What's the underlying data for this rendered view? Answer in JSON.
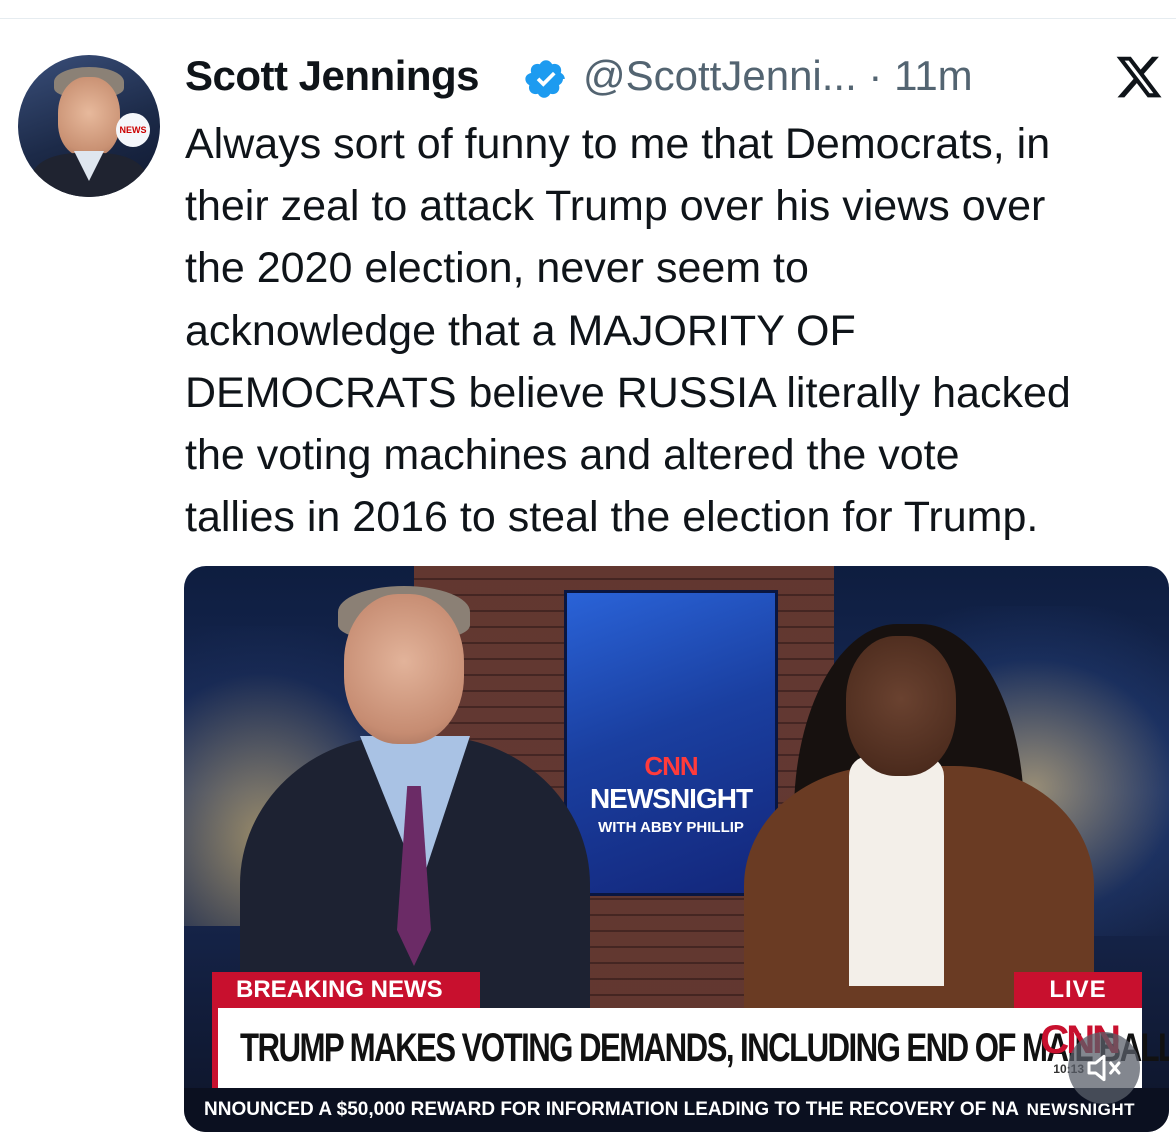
{
  "tweet": {
    "author_name": "Scott Jennings",
    "handle_time": "@ScottJenni... · 11m",
    "text_lines": [
      "Always sort of funny to me that Democrats, in",
      "their zeal to attack Trump over his views over",
      "the 2020 election, never seem to",
      "acknowledge that a MAJORITY OF",
      "DEMOCRATS believe RUSSIA literally hacked",
      "the voting machines and altered the vote",
      "tallies in 2016 to steal the election for Trump."
    ],
    "verified_icon": "verified-badge-icon",
    "platform_icon": "x-logo-icon",
    "avatar_badge": "NEWS"
  },
  "media": {
    "screen_cnn": "CNN",
    "screen_show": "NEWSNIGHT",
    "screen_host": "WITH ABBY PHILLIP",
    "breaking_label": "BREAKING NEWS",
    "live_label": "LIVE",
    "headline": "TRUMP MAKES VOTING DEMANDS, INCLUDING END OF MAIL BALLOTS",
    "network_logo": "CNN",
    "clock": "10:13",
    "ticker_text": "NNOUNCED A $50,000 REWARD FOR INFORMATION LEADING TO THE RECOVERY OF NA",
    "ticker_brand": "NEWSNIGHT",
    "mute_icon": "speaker-muted-icon"
  },
  "colors": {
    "text": "#0f1419",
    "secondary": "#536471",
    "verified": "#1d9bf0",
    "cnn_red": "#c8102e"
  }
}
